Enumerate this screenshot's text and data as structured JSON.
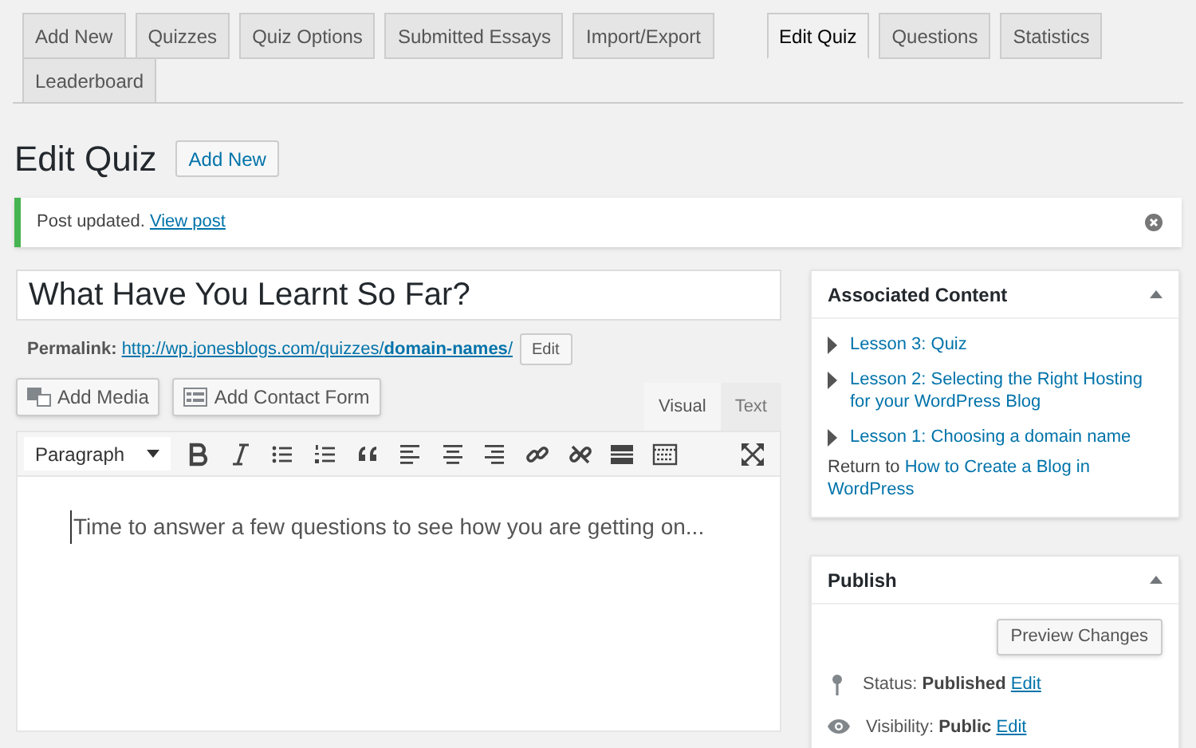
{
  "tabs": [
    {
      "label": "Add New",
      "selected": false,
      "kind": "plugin"
    },
    {
      "label": "Quizzes",
      "selected": false,
      "kind": "plugin"
    },
    {
      "label": "Quiz Options",
      "selected": false,
      "kind": "plugin"
    },
    {
      "label": "Submitted Essays",
      "selected": false,
      "kind": "plugin"
    },
    {
      "label": "Import/Export",
      "selected": false,
      "kind": "plugin"
    },
    {
      "label": "Edit Quiz",
      "selected": true,
      "kind": "quiz"
    },
    {
      "label": "Questions",
      "selected": false,
      "kind": "quiz"
    },
    {
      "label": "Statistics",
      "selected": false,
      "kind": "quiz"
    },
    {
      "label": "Leaderboard",
      "selected": false,
      "kind": "quiz"
    }
  ],
  "heading": {
    "title": "Edit Quiz",
    "action": "Add New"
  },
  "notice": {
    "message": "Post updated.",
    "link": "View post"
  },
  "post_title": "What Have You Learnt So Far?",
  "permalink": {
    "label": "Permalink:",
    "url_base": "http://wp.jonesblogs.com/quizzes/",
    "slug": "domain-names",
    "url_end": "/",
    "edit": "Edit"
  },
  "media_buttons": [
    {
      "label": "Add Media",
      "kind": "media"
    },
    {
      "label": "Add Contact Form",
      "kind": "form"
    }
  ],
  "editor_tabs": [
    {
      "label": "Visual",
      "selected": true
    },
    {
      "label": "Text",
      "selected": false
    }
  ],
  "format_select": "Paragraph",
  "toolbar": [
    {
      "kind": "bold"
    },
    {
      "kind": "italic"
    },
    {
      "kind": "bullets"
    },
    {
      "kind": "numbers"
    },
    {
      "kind": "quote"
    },
    {
      "kind": "align-left"
    },
    {
      "kind": "align-center"
    },
    {
      "kind": "align-right"
    },
    {
      "kind": "link"
    },
    {
      "kind": "unlink"
    },
    {
      "kind": "more"
    },
    {
      "kind": "kitchen-sink"
    },
    {
      "kind": "fullscreen"
    }
  ],
  "editor_text": "Time to answer a few questions to see how you are getting on...",
  "associated": {
    "title": "Associated Content",
    "lessons": [
      "Lesson 3: Quiz",
      "Lesson 2: Selecting the Right Hosting for your WordPress Blog",
      "Lesson 1: Choosing a domain name"
    ],
    "return_prefix": "Return to",
    "return_link": [
      "How to Create a Blog in",
      "WordPress"
    ]
  },
  "publish": {
    "title": "Publish",
    "preview": "Preview Changes",
    "status_label": "Status:",
    "status": "Published",
    "status_edit": "Edit",
    "visibility_label": "Visibility:",
    "visibility": "Public",
    "visibility_edit": "Edit"
  }
}
